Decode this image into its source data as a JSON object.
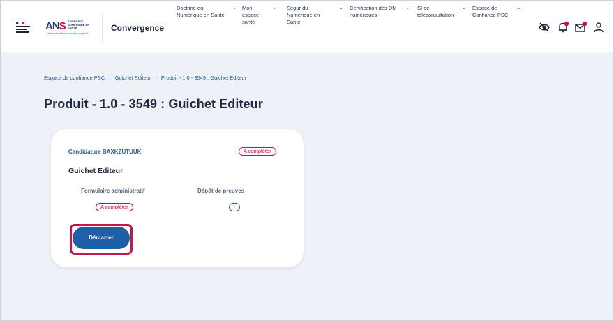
{
  "header": {
    "app_name": "Convergence",
    "ans_logo": {
      "text": "AGENCE DU NUMÉRIQUE EN SANTÉ",
      "tagline": "La transformation numérique en santé"
    },
    "nav": [
      {
        "line1": "Doctrine du",
        "line2": "Numérique en Santé",
        "line3": ""
      },
      {
        "line1": "Mon",
        "line2": "espace",
        "line3": "santé"
      },
      {
        "line1": "Ségur du",
        "line2": "Numérique en",
        "line3": "Santé"
      },
      {
        "line1": "Certification des DM",
        "line2": "numériques",
        "line3": ""
      },
      {
        "line1": "SI de",
        "line2": "téléconsultation",
        "line3": ""
      },
      {
        "line1": "Espace de",
        "line2": "Confiance PSC",
        "line3": ""
      }
    ],
    "icons": [
      "eye-off-icon",
      "bell-icon",
      "mail-icon",
      "user-icon"
    ]
  },
  "breadcrumb": {
    "items": [
      "Espace de confiance PSC",
      "Guichet Editeur",
      "Produit - 1.0 - 3549 : Guichet Editeur"
    ],
    "separator": "›"
  },
  "page_title": "Produit - 1.0 - 3549 : Guichet Editeur",
  "card": {
    "candidature": "Candidature BAXKZUTUUK",
    "status": "A compléter",
    "title": "Guichet Editeur",
    "col_admin": "Formulaire administratif",
    "col_proofs": "Dépôt de preuves",
    "admin_status": "A compléter",
    "proofs_status": "-",
    "start_button": "Démarrer"
  },
  "colors": {
    "primary": "#1f5fa8",
    "accent": "#e0004d",
    "highlight": "#c8154e",
    "background": "#eef1f7"
  }
}
